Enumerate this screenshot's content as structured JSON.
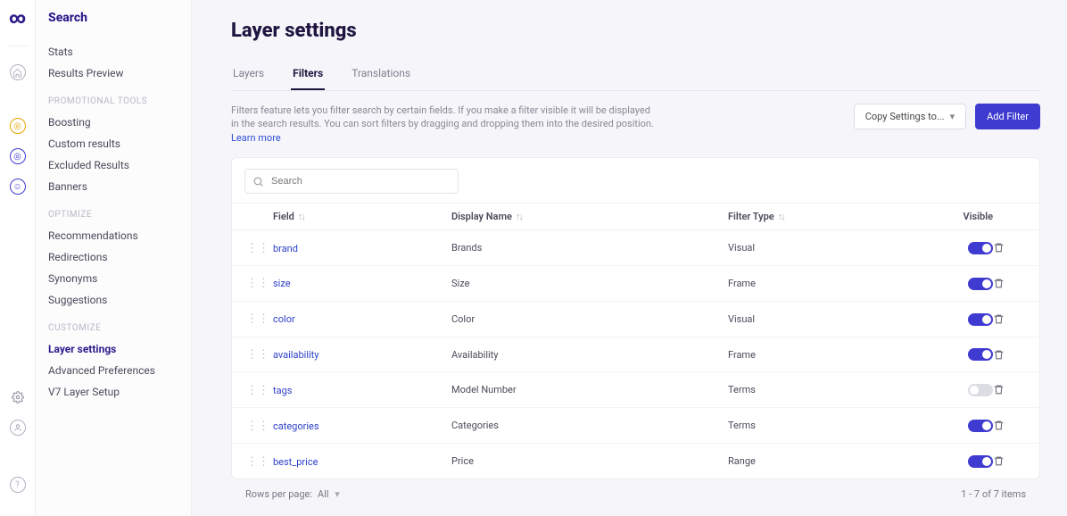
{
  "sidebar": {
    "title": "Search",
    "groups": [
      {
        "label": "",
        "items": [
          {
            "key": "stats",
            "label": "Stats"
          },
          {
            "key": "results-preview",
            "label": "Results Preview"
          }
        ]
      },
      {
        "label": "PROMOTIONAL TOOLS",
        "items": [
          {
            "key": "boosting",
            "label": "Boosting"
          },
          {
            "key": "custom-results",
            "label": "Custom results"
          },
          {
            "key": "excluded-results",
            "label": "Excluded Results"
          },
          {
            "key": "banners",
            "label": "Banners"
          }
        ]
      },
      {
        "label": "OPTIMIZE",
        "items": [
          {
            "key": "recommendations",
            "label": "Recommendations"
          },
          {
            "key": "redirections",
            "label": "Redirections"
          },
          {
            "key": "synonyms",
            "label": "Synonyms"
          },
          {
            "key": "suggestions",
            "label": "Suggestions"
          }
        ]
      },
      {
        "label": "CUSTOMIZE",
        "items": [
          {
            "key": "layer-settings",
            "label": "Layer settings",
            "active": true
          },
          {
            "key": "advanced-preferences",
            "label": "Advanced Preferences"
          },
          {
            "key": "v7-layer-setup",
            "label": "V7 Layer Setup"
          }
        ]
      }
    ]
  },
  "page": {
    "title": "Layer settings",
    "description_pre": "Filters feature lets you filter search by certain fields. If you make a filter visible it will be displayed in the search results. You can sort filters by dragging and dropping them into the desired position. ",
    "description_link": "Learn more",
    "copy_settings_label": "Copy Settings to...",
    "add_filter_label": "Add Filter",
    "search_placeholder": "Search"
  },
  "tabs": [
    {
      "key": "layers",
      "label": "Layers"
    },
    {
      "key": "filters",
      "label": "Filters",
      "active": true
    },
    {
      "key": "translations",
      "label": "Translations"
    }
  ],
  "table": {
    "headers": {
      "field": "Field",
      "display": "Display Name",
      "type": "Filter Type",
      "visible": "Visible"
    },
    "rows": [
      {
        "field": "brand",
        "display": "Brands",
        "type": "Visual",
        "visible": true
      },
      {
        "field": "size",
        "display": "Size",
        "type": "Frame",
        "visible": true
      },
      {
        "field": "color",
        "display": "Color",
        "type": "Visual",
        "visible": true
      },
      {
        "field": "availability",
        "display": "Availability",
        "type": "Frame",
        "visible": true
      },
      {
        "field": "tags",
        "display": "Model Number",
        "type": "Terms",
        "visible": false
      },
      {
        "field": "categories",
        "display": "Categories",
        "type": "Terms",
        "visible": true
      },
      {
        "field": "best_price",
        "display": "Price",
        "type": "Range",
        "visible": true
      }
    ]
  },
  "footer": {
    "rows_per_page_label": "Rows per page:",
    "rows_per_page_value": "All",
    "range": "1 - 7 of 7 items"
  }
}
